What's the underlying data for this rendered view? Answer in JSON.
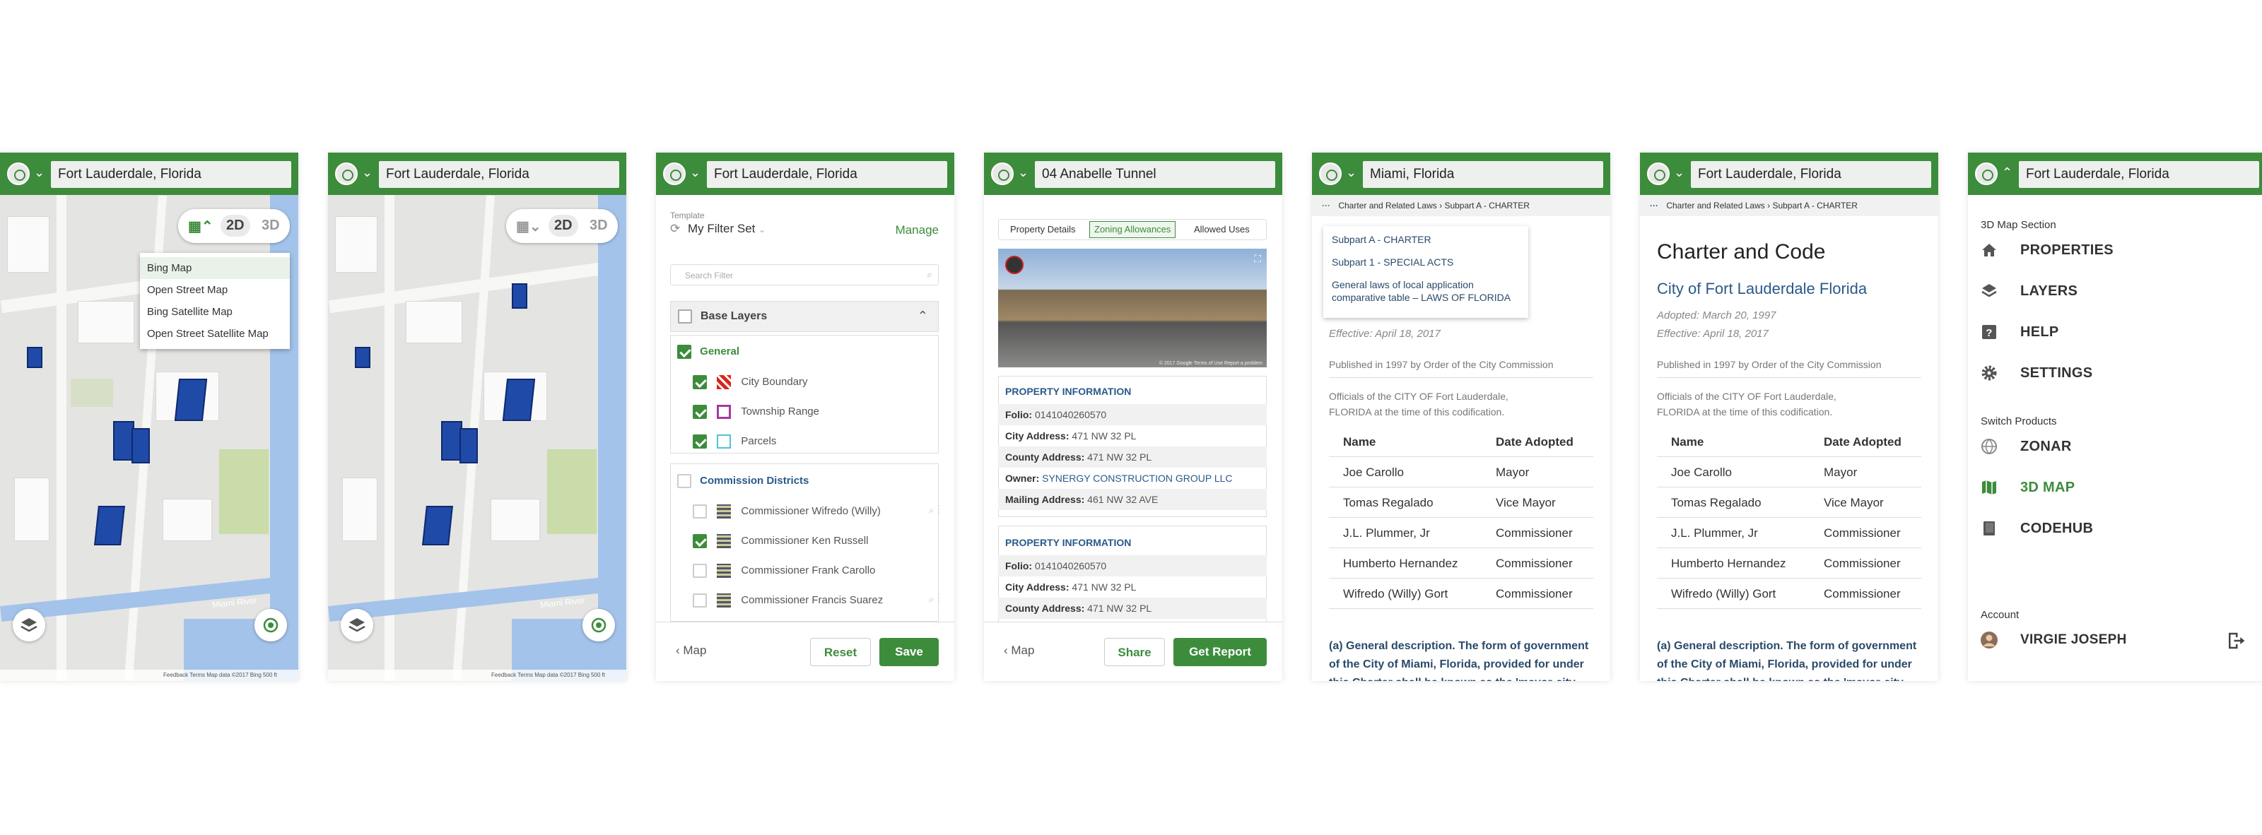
{
  "phone1": {
    "search_value": "Fort Lauderdale, Florida",
    "mode_2d": "2D",
    "mode_3d": "3D",
    "basemap_options": [
      "Bing Map",
      "Open Street Map",
      "Bing Satellite Map",
      "Open Street Satellite Map"
    ],
    "attribution": "Feedback   Terms   Map data ©2017 Bing   500 ft",
    "river_label": "Miami River"
  },
  "phone2": {
    "search_value": "Fort Lauderdale, Florida",
    "mode_2d": "2D",
    "mode_3d": "3D",
    "attribution": "Feedback   Terms   Map data ©2017 Bing   500 ft",
    "river_label": "Miami River"
  },
  "phone3": {
    "search_value": "Fort Lauderdale, Florida",
    "template_label": "Template",
    "filter_set": "My Filter Set",
    "manage": "Manage",
    "search_placeholder": "Search Filter",
    "base_layers": "Base Layers",
    "general": "General",
    "general_items": [
      "City Boundary",
      "Township Range",
      "Parcels"
    ],
    "commission_districts": "Commission Districts",
    "commission_items": [
      "Commissioner Wifredo (Willy)",
      "Commissioner Ken Russell",
      "Commissioner Frank Carollo",
      "Commissioner Francis Suarez"
    ],
    "back": "Map",
    "reset": "Reset",
    "save": "Save",
    "colors": {
      "accent": "#3d8c3c",
      "city_boundary": "#d9251c",
      "township_range": "#a53aa0",
      "parcels": "#4fc3d4"
    }
  },
  "phone4": {
    "search_value": "04 Anabelle Tunnel",
    "tabs": [
      "Property Details",
      "Zoning Allowances",
      "Allowed Uses"
    ],
    "section1": "PROPERTY INFORMATION",
    "rows1": [
      {
        "k": "Folio:",
        "v": "0141040260570"
      },
      {
        "k": "City Address:",
        "v": "471 NW 32 PL"
      },
      {
        "k": "County Address:",
        "v": "471 NW 32 PL"
      },
      {
        "k": "Owner:",
        "v": "SYNERGY CONSTRUCTION GROUP LLC"
      },
      {
        "k": "Mailing Address:",
        "v": "461 NW 32 AVE"
      }
    ],
    "section2": "PROPERTY INFORMATION",
    "rows2": [
      {
        "k": "Folio:",
        "v": "0141040260570"
      },
      {
        "k": "City Address:",
        "v": "471 NW 32 PL"
      },
      {
        "k": "County Address:",
        "v": "471 NW 32 PL"
      }
    ],
    "photo_credit": "© 2017 Google   Terms of Use   Report a problem",
    "back": "Map",
    "share": "Share",
    "get_report": "Get Report"
  },
  "phone5": {
    "search_value": "Miami, Florida",
    "breadcrumb": [
      "Charter and Related Laws",
      "Subpart A - CHARTER"
    ],
    "dropdown": [
      "Subpart A - CHARTER",
      "Subpart 1 - SPECIAL ACTS",
      "General laws of local application comparative table – LAWS OF FLORIDA"
    ],
    "effective": "Effective: April 18, 2017",
    "published": "Published in 1997 by Order of the City Commission",
    "officials": "Officials of the CITY OF Fort Lauderdale, FLORIDA at the time of this codification.",
    "col_name": "Name",
    "col_date": "Date  Adopted",
    "people": [
      {
        "name": "Joe Carollo",
        "role": "Mayor"
      },
      {
        "name": "Tomas Regalado",
        "role": "Vice Mayor"
      },
      {
        "name": "J.L. Plummer, Jr",
        "role": "Commissioner"
      },
      {
        "name": "Humberto Hernandez",
        "role": "Commissioner"
      },
      {
        "name": "Wifredo (Willy) Gort",
        "role": "Commissioner"
      }
    ],
    "paragraph": "(a) General description. The form of government of the City of Miami, Florida, provided for under this Charter shall be known as the 'mayor-city"
  },
  "phone6": {
    "search_value": "Fort Lauderdale, Florida",
    "breadcrumb": [
      "Charter and Related Laws",
      "Subpart A - CHARTER"
    ],
    "heading": "Charter and Code",
    "subheading": "City of Fort Lauderdale Florida",
    "adopted": "Adopted: March 20, 1997",
    "effective": "Effective: April 18, 2017",
    "published": "Published in 1997 by Order of the City Commission",
    "officials": "Officials of the CITY OF Fort Lauderdale, FLORIDA at the time of this codification.",
    "col_name": "Name",
    "col_date": "Date  Adopted",
    "people": [
      {
        "name": "Joe Carollo",
        "role": "Mayor"
      },
      {
        "name": "Tomas Regalado",
        "role": "Vice Mayor"
      },
      {
        "name": "J.L. Plummer, Jr",
        "role": "Commissioner"
      },
      {
        "name": "Humberto Hernandez",
        "role": "Commissioner"
      },
      {
        "name": "Wifredo (Willy) Gort",
        "role": "Commissioner"
      }
    ],
    "paragraph": "(a) General description. The form of government of the City of Miami, Florida, provided for under this Charter shall be known as the 'mayor-city"
  },
  "phone7": {
    "search_value": "Fort Lauderdale, Florida",
    "section_title": "3D Map Section",
    "menu": [
      {
        "label": "PROPERTIES",
        "icon": "home-icon"
      },
      {
        "label": "LAYERS",
        "icon": "layers-icon"
      },
      {
        "label": "HELP",
        "icon": "help-icon"
      },
      {
        "label": "SETTINGS",
        "icon": "gear-icon"
      }
    ],
    "switch_title": "Switch Products",
    "products": [
      {
        "label": "ZONAR",
        "icon": "globe-icon"
      },
      {
        "label": "3D MAP",
        "icon": "map-icon"
      },
      {
        "label": "CODEHUB",
        "icon": "book-icon"
      }
    ],
    "account_title": "Account",
    "user_name": "VIRGIE JOSEPH"
  }
}
